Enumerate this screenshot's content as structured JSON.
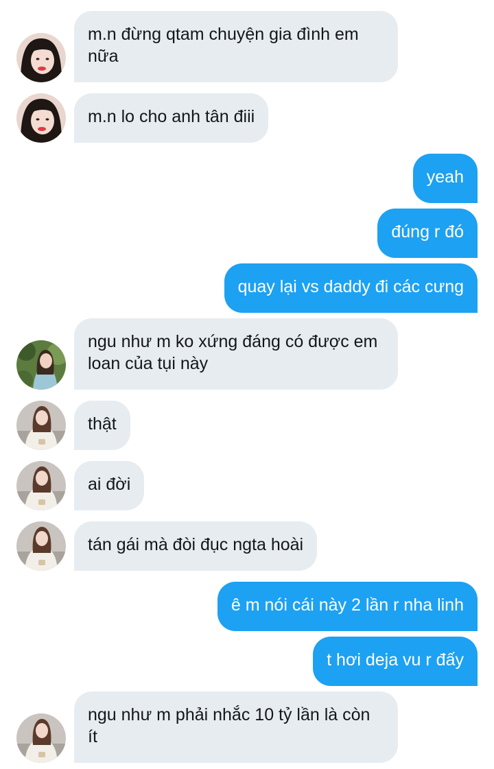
{
  "conversation": {
    "messages": [
      {
        "side": "in",
        "text": "m.n đừng qtam chuyện gia đình em nữa",
        "avatar": "avatar-girl-red-lips"
      },
      {
        "side": "in",
        "text": "m.n lo cho anh tân điii",
        "avatar": "avatar-girl-red-lips"
      },
      {
        "side": "out",
        "text": "yeah"
      },
      {
        "side": "out",
        "text": "đúng r đó"
      },
      {
        "side": "out",
        "text": "quay lại vs daddy đi các cưng"
      },
      {
        "side": "in",
        "text": "ngu như m ko xứng đáng có được em loan của tụi này",
        "avatar": "avatar-girl-garden"
      },
      {
        "side": "in",
        "text": "thật",
        "avatar": "avatar-girl-white-sweater"
      },
      {
        "side": "in",
        "text": "ai đời",
        "avatar": "avatar-girl-white-sweater"
      },
      {
        "side": "in",
        "text": "tán gái mà đòi đục ngta hoài",
        "avatar": "avatar-girl-white-sweater"
      },
      {
        "side": "out",
        "text": "ê m nói cái này 2 lần r nha linh"
      },
      {
        "side": "out",
        "text": "t hơi deja vu r đấy"
      },
      {
        "side": "in",
        "text": "ngu như m phải nhắc 10 tỷ lần là còn ít",
        "avatar": "avatar-girl-white-sweater"
      }
    ]
  },
  "colors": {
    "incoming_bubble": "#e6ecf0",
    "outgoing_bubble": "#1da1f2",
    "incoming_text": "#14171a",
    "outgoing_text": "#ffffff"
  }
}
